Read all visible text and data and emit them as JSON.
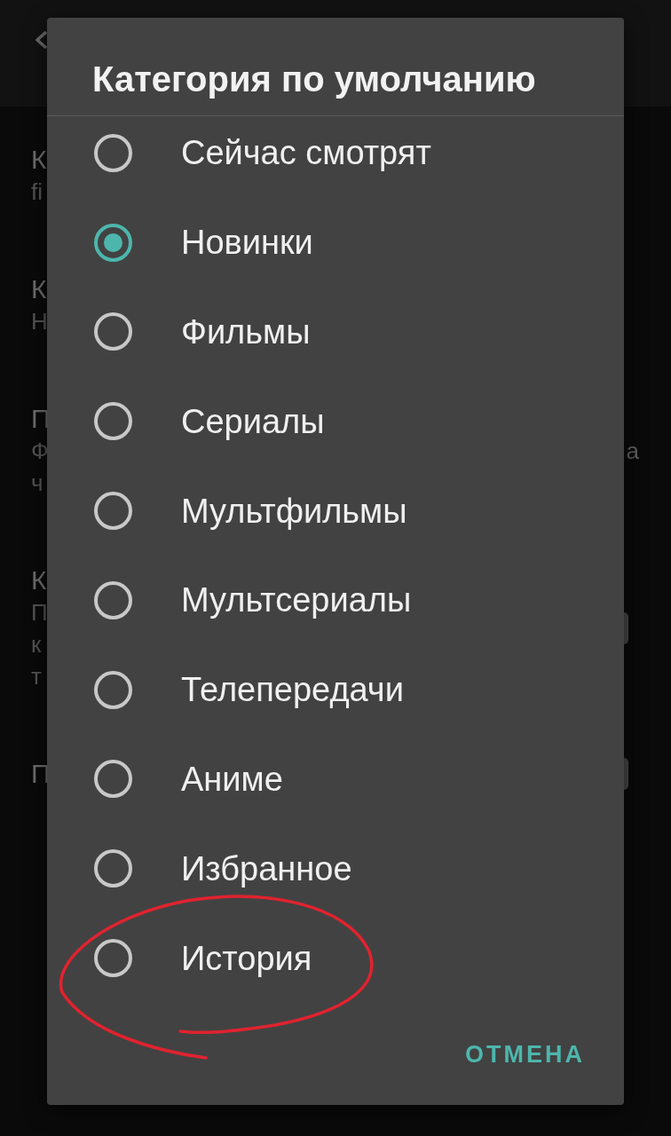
{
  "background_screen": {
    "settings": [
      {
        "kind": "text",
        "title": "К",
        "summary_lines": [
          "fi"
        ]
      },
      {
        "kind": "text",
        "title": "К",
        "summary_lines": [
          "Н"
        ]
      },
      {
        "kind": "text",
        "title": "П",
        "summary_lines": [
          "Ф",
          "ч"
        ],
        "right_text": "а"
      },
      {
        "kind": "switch",
        "title": "К",
        "summary_lines": [
          "П",
          "к",
          "т"
        ],
        "on": false
      },
      {
        "kind": "switch",
        "title": "П",
        "on": false
      }
    ]
  },
  "dialog": {
    "title": "Категория по умолчанию",
    "options": [
      {
        "label": "Сейчас смотрят",
        "selected": false
      },
      {
        "label": "Новинки",
        "selected": true
      },
      {
        "label": "Фильмы",
        "selected": false
      },
      {
        "label": "Сериалы",
        "selected": false
      },
      {
        "label": "Мультфильмы",
        "selected": false
      },
      {
        "label": "Мультсериалы",
        "selected": false
      },
      {
        "label": "Телепередачи",
        "selected": false
      },
      {
        "label": "Аниме",
        "selected": false
      },
      {
        "label": "Избранное",
        "selected": false
      },
      {
        "label": "История",
        "selected": false
      }
    ],
    "cancel_button": "ОТМЕНА"
  }
}
